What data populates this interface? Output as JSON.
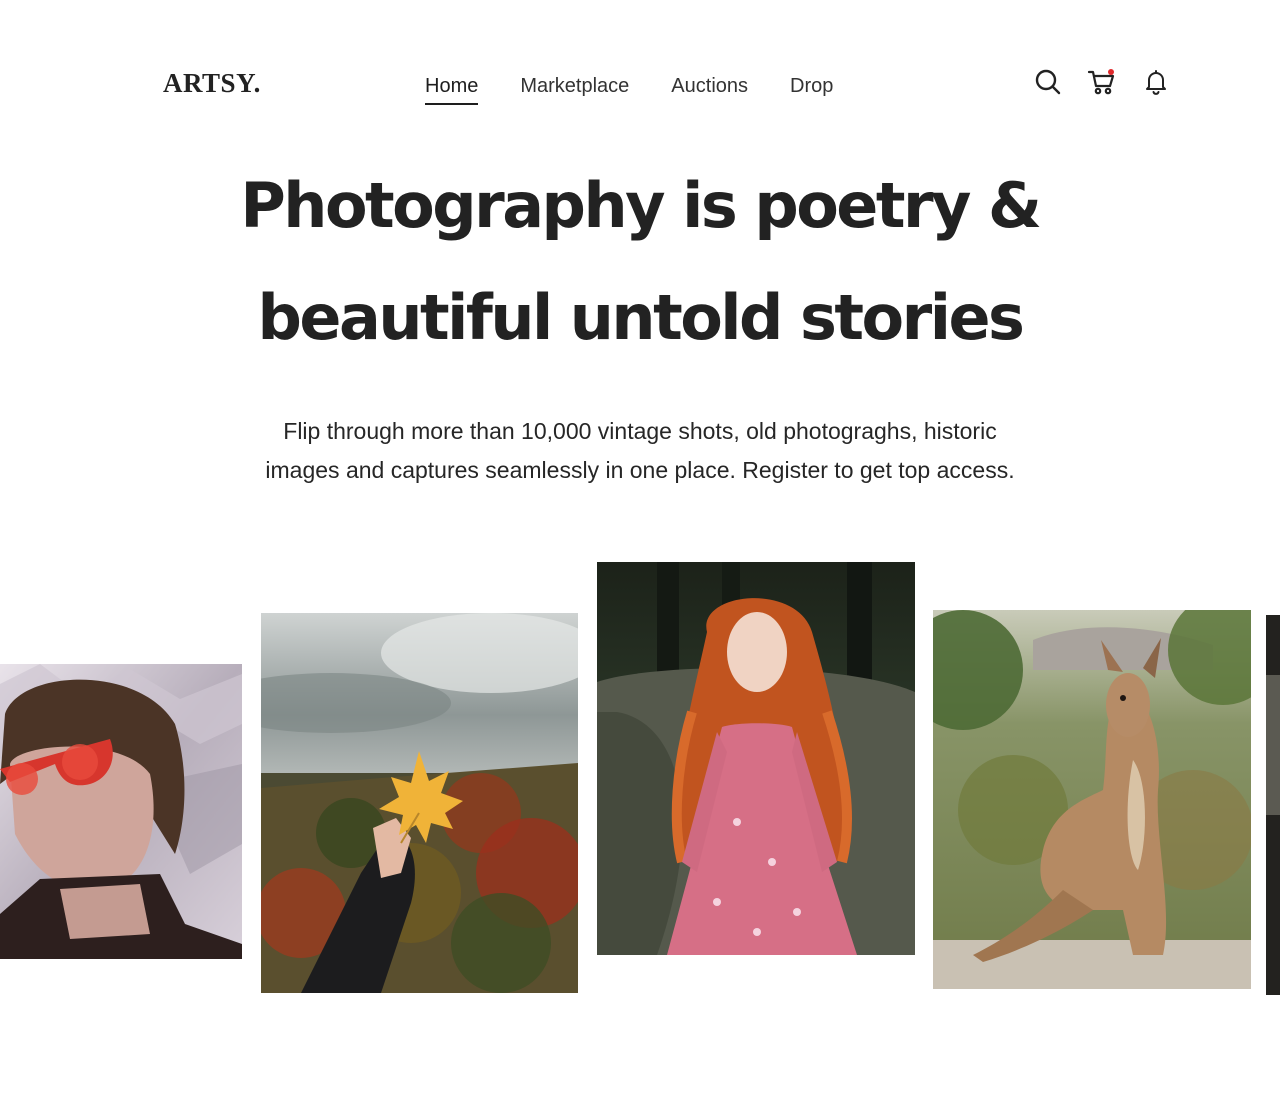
{
  "header": {
    "logo": "ARTSY.",
    "nav": [
      {
        "label": "Home",
        "active": true
      },
      {
        "label": "Marketplace",
        "active": false
      },
      {
        "label": "Auctions",
        "active": false
      },
      {
        "label": "Drop",
        "active": false
      }
    ],
    "icons": [
      "search-icon",
      "cart-icon",
      "bell-icon"
    ],
    "cart_has_notification": true,
    "notification_color": "#e0292b"
  },
  "hero": {
    "title_line1": "Photography is poetry &",
    "title_line2": "beautiful untold stories",
    "subtitle_line1": "Flip through more than 10,000 vintage shots, old photograghs, historic",
    "subtitle_line2": "images and captures seamlessly in one place. Register to get top access."
  },
  "gallery": [
    {
      "subject": "person-red-sunglasses-foil"
    },
    {
      "subject": "hand-holding-maple-leaf-autumn-forest"
    },
    {
      "subject": "red-haired-woman-pink-dress"
    },
    {
      "subject": "kangaroo-in-grass"
    },
    {
      "subject": "partial-dark-photo"
    }
  ],
  "colors": {
    "text": "#222222",
    "background": "#ffffff"
  }
}
